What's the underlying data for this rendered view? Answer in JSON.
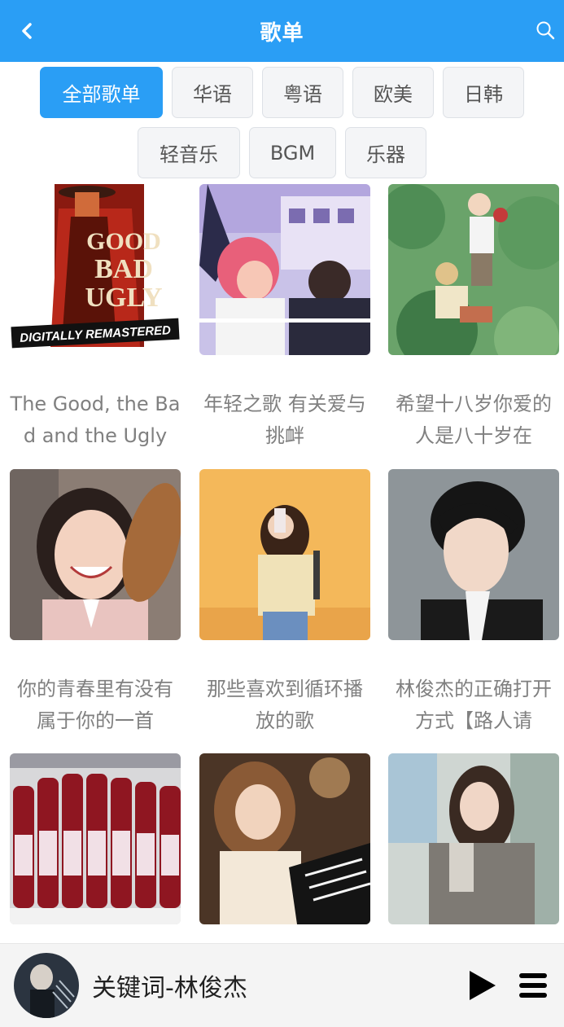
{
  "header": {
    "title": "歌单"
  },
  "filters": {
    "row1": [
      "全部歌单",
      "华语",
      "粤语",
      "欧美",
      "日韩"
    ],
    "row2": [
      "轻音乐",
      "BGM",
      "乐器"
    ],
    "active": "全部歌单"
  },
  "playlists": [
    {
      "title": "The Good, the Bad and the Ugly",
      "cover_text": "GOOD BAD UGLY",
      "cover_badge": "DIGITALLY REMASTERED"
    },
    {
      "title": "年轻之歌 有关爱与挑衅"
    },
    {
      "title": "希望十八岁你爱的人是八十岁在"
    },
    {
      "title": "你的青春里有没有属于你的一首"
    },
    {
      "title": "那些喜欢到循环播放的歌"
    },
    {
      "title": "林俊杰的正确打开方式【路人请"
    },
    {
      "title": ""
    },
    {
      "title": ""
    },
    {
      "title": ""
    }
  ],
  "player": {
    "now_playing": "关键词-林俊杰"
  },
  "colors": {
    "accent": "#2a9ef5"
  }
}
